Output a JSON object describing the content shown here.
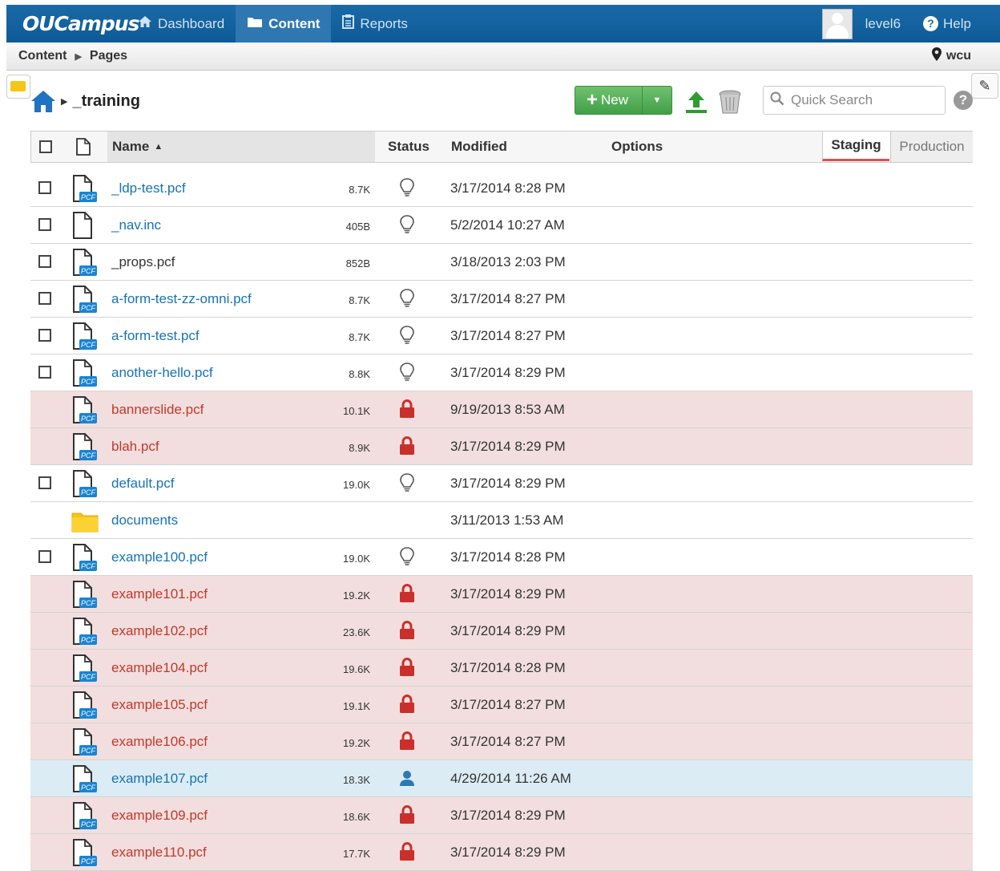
{
  "topnav": {
    "logo": "OUCampus",
    "items": [
      {
        "label": "Dashboard",
        "icon": "home-icon",
        "active": false
      },
      {
        "label": "Content",
        "icon": "folder-icon",
        "active": true
      },
      {
        "label": "Reports",
        "icon": "clipboard-icon",
        "active": false
      }
    ],
    "user": "level6",
    "help": "Help"
  },
  "breadcrumb": {
    "items": [
      "Content",
      "Pages"
    ],
    "site": "wcu"
  },
  "path": {
    "current_folder": "_training"
  },
  "toolbar": {
    "new_label": "New",
    "search_placeholder": "Quick Search"
  },
  "table": {
    "headers": {
      "name": "Name",
      "status": "Status",
      "modified": "Modified",
      "options": "Options",
      "staging": "Staging",
      "production": "Production"
    },
    "rows": [
      {
        "name": "_ldp-test.pcf",
        "size": "8.7K",
        "status": "bulb",
        "modified": "3/17/2014 8:28 PM",
        "type": "pcf",
        "state": "normal",
        "checkbox": true
      },
      {
        "name": "_nav.inc",
        "size": "405B",
        "status": "bulb",
        "modified": "5/2/2014 10:27 AM",
        "type": "file",
        "state": "normal",
        "checkbox": true
      },
      {
        "name": "_props.pcf",
        "size": "852B",
        "status": "",
        "modified": "3/18/2013 2:03 PM",
        "type": "pcf",
        "state": "plain",
        "checkbox": true
      },
      {
        "name": "a-form-test-zz-omni.pcf",
        "size": "8.7K",
        "status": "bulb",
        "modified": "3/17/2014 8:27 PM",
        "type": "pcf",
        "state": "normal",
        "checkbox": true
      },
      {
        "name": "a-form-test.pcf",
        "size": "8.7K",
        "status": "bulb",
        "modified": "3/17/2014 8:27 PM",
        "type": "pcf",
        "state": "normal",
        "checkbox": true
      },
      {
        "name": "another-hello.pcf",
        "size": "8.8K",
        "status": "bulb",
        "modified": "3/17/2014 8:29 PM",
        "type": "pcf",
        "state": "normal",
        "checkbox": true
      },
      {
        "name": "bannerslide.pcf",
        "size": "10.1K",
        "status": "lock",
        "modified": "9/19/2013 8:53 AM",
        "type": "pcf",
        "state": "locked",
        "checkbox": false
      },
      {
        "name": "blah.pcf",
        "size": "8.9K",
        "status": "lock",
        "modified": "3/17/2014 8:29 PM",
        "type": "pcf",
        "state": "locked",
        "checkbox": false
      },
      {
        "name": "default.pcf",
        "size": "19.0K",
        "status": "bulb",
        "modified": "3/17/2014 8:29 PM",
        "type": "pcf",
        "state": "normal",
        "checkbox": true
      },
      {
        "name": "documents",
        "size": "",
        "status": "",
        "modified": "3/11/2013 1:53 AM",
        "type": "folder",
        "state": "normal",
        "checkbox": false
      },
      {
        "name": "example100.pcf",
        "size": "19.0K",
        "status": "bulb",
        "modified": "3/17/2014 8:28 PM",
        "type": "pcf",
        "state": "normal",
        "checkbox": true
      },
      {
        "name": "example101.pcf",
        "size": "19.2K",
        "status": "lock",
        "modified": "3/17/2014 8:29 PM",
        "type": "pcf",
        "state": "locked",
        "checkbox": false
      },
      {
        "name": "example102.pcf",
        "size": "23.6K",
        "status": "lock",
        "modified": "3/17/2014 8:29 PM",
        "type": "pcf",
        "state": "locked",
        "checkbox": false
      },
      {
        "name": "example104.pcf",
        "size": "19.6K",
        "status": "lock",
        "modified": "3/17/2014 8:28 PM",
        "type": "pcf",
        "state": "locked",
        "checkbox": false
      },
      {
        "name": "example105.pcf",
        "size": "19.1K",
        "status": "lock",
        "modified": "3/17/2014 8:27 PM",
        "type": "pcf",
        "state": "locked",
        "checkbox": false
      },
      {
        "name": "example106.pcf",
        "size": "19.2K",
        "status": "lock",
        "modified": "3/17/2014 8:27 PM",
        "type": "pcf",
        "state": "locked",
        "checkbox": false
      },
      {
        "name": "example107.pcf",
        "size": "18.3K",
        "status": "user",
        "modified": "4/29/2014 11:26 AM",
        "type": "pcf",
        "state": "checkedout",
        "checkbox": false
      },
      {
        "name": "example109.pcf",
        "size": "18.6K",
        "status": "lock",
        "modified": "3/17/2014 8:29 PM",
        "type": "pcf",
        "state": "locked",
        "checkbox": false
      },
      {
        "name": "example110.pcf",
        "size": "17.7K",
        "status": "lock",
        "modified": "3/17/2014 8:29 PM",
        "type": "pcf",
        "state": "locked",
        "checkbox": false
      }
    ]
  },
  "colors": {
    "nav_bg": "#1a6aa8",
    "link": "#1673b5",
    "locked_row": "#f2dede",
    "locked_text": "#c0392b",
    "checkedout_row": "#dcecf5",
    "new_button": "#4cae4c"
  }
}
